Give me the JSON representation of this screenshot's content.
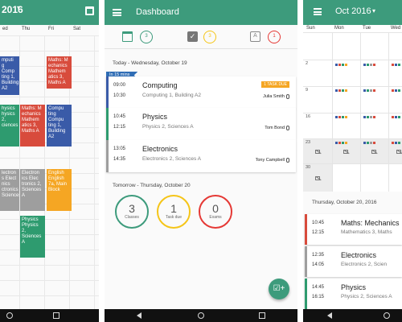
{
  "colors": {
    "primary": "#3d9b7c",
    "computing": "#3a5ba8",
    "maths": "#d84b3c",
    "physics": "#2e9b6f",
    "electronics": "#9e9e9e",
    "english": "#f5a623",
    "classes": "#3d9b7c",
    "tasks": "#f5c518",
    "exams": "#e53935"
  },
  "week_view": {
    "title": "2016",
    "caret": "▾",
    "calendar_icon": "calendar-icon",
    "days": [
      "ed",
      "Thu",
      "Fri",
      "Sat"
    ],
    "events": [
      {
        "lines": [
          "mputi",
          "g Comp",
          "ting 1,",
          "Building",
          "A2"
        ],
        "color": "computing"
      },
      {
        "lines": [
          "Maths: M",
          "echanics",
          "Mathem",
          "atics 3,",
          "Maths A"
        ],
        "color": "maths"
      },
      {
        "lines": [
          "hysics",
          "hysics 2,",
          "ciences"
        ],
        "color": "physics"
      },
      {
        "lines": [
          "Maths: M",
          "echanics",
          "Mathem",
          "atics 3,",
          "Maths A"
        ],
        "color": "maths"
      },
      {
        "lines": [
          "Compu",
          "ting",
          "Compu",
          "ting 1,",
          "Building",
          "A2"
        ],
        "color": "computing"
      },
      {
        "lines": [
          "lectron",
          "s Elect",
          "nics",
          "ctronics",
          "Sciences"
        ],
        "color": "electronics"
      },
      {
        "lines": [
          "Electron",
          "ics Elec",
          "tronics 2,",
          "Sciences",
          "A"
        ],
        "color": "electronics"
      },
      {
        "lines": [
          "English",
          "English",
          "7a, Main",
          "Block"
        ],
        "color": "english"
      },
      {
        "lines": [
          "Physics",
          "Physics 2,",
          "Sciences",
          "A"
        ],
        "color": "physics"
      }
    ]
  },
  "dashboard": {
    "title": "Dashboard",
    "stats": [
      {
        "icon": "calendar-check-icon",
        "count": "3",
        "color": "classes"
      },
      {
        "icon": "checkbox-icon",
        "count": "3",
        "color": "tasks"
      },
      {
        "icon": "exam-icon",
        "icon_text": "A",
        "count": "1",
        "color": "exams"
      }
    ],
    "today_header": "Today - Wednesday, October 19",
    "in_badge": "In 15 mins",
    "today_classes": [
      {
        "start": "09:00",
        "end": "10:30",
        "name": "Computing",
        "location": "Computing 1, Building A2",
        "teacher": "Julia Smith",
        "task_badge": "1 TASK DUE",
        "color": "computing"
      },
      {
        "start": "10:45",
        "end": "12:15",
        "name": "Physics",
        "location": "Physics 2, Sciences A",
        "teacher": "Tom Bond",
        "task_badge": "",
        "color": "physics"
      },
      {
        "start": "13:05",
        "end": "14:35",
        "name": "Electronics",
        "location": "Electronics 2, Sciences A",
        "teacher": "Tony Campbell",
        "task_badge": "",
        "color": "electronics"
      }
    ],
    "tomorrow_header": "Tomorrow - Thursday, October 20",
    "summary": [
      {
        "number": "3",
        "label": "Classes",
        "color": "classes"
      },
      {
        "number": "1",
        "label": "Task due",
        "color": "tasks"
      },
      {
        "number": "0",
        "label": "Exams",
        "color": "exams"
      }
    ],
    "fab_icon": "add-task-icon",
    "fab_glyph": "☑+"
  },
  "month_view": {
    "title": "Oct 2016",
    "caret": "▾",
    "days": [
      "Sun",
      "Mon",
      "Tue",
      "Wed"
    ],
    "week_starts": [
      "",
      "2",
      "9",
      "16",
      "23",
      "30"
    ],
    "date_header": "Thursday, October 20, 2016",
    "classes": [
      {
        "start": "10:45",
        "end": "12:15",
        "name": "Maths: Mechanics",
        "location": "Mathematics 3, Maths",
        "color": "maths"
      },
      {
        "start": "12:35",
        "end": "14:05",
        "name": "Electronics",
        "location": "Electronics 2, Scien",
        "color": "electronics"
      },
      {
        "start": "14:45",
        "end": "16:15",
        "name": "Physics",
        "location": "Physics 2, Sciences A",
        "color": "physics"
      }
    ]
  }
}
